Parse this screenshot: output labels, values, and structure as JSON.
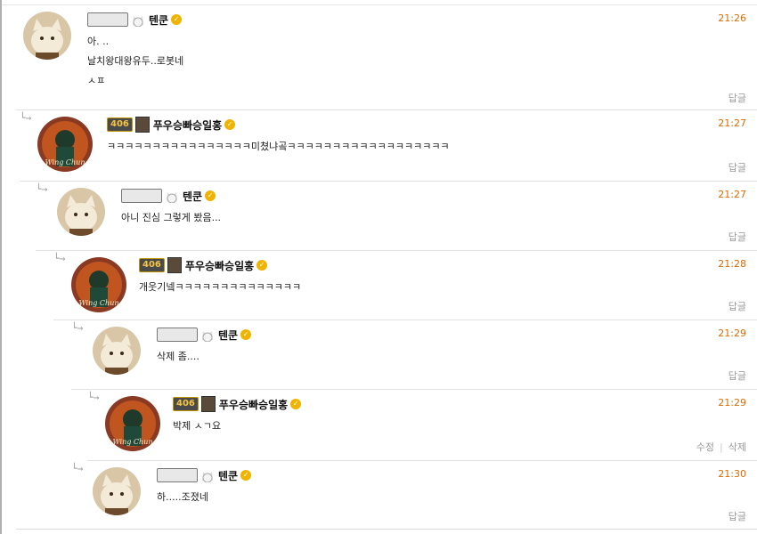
{
  "comments": [
    {
      "author": "텐쿤",
      "time": "21:26",
      "lines": [
        "아. ..",
        "날치왕대왕유두..로봇네",
        "ㅅㅍ"
      ],
      "reply": "답글"
    },
    {
      "author": "푸우승빠승일홍",
      "badge": "406",
      "time": "21:27",
      "lines": [
        "ㅋㅋㅋㅋㅋㅋㅋㅋㅋㅋㅋㅋㅋㅋㅋㅋ미쳤냐곸ㅋㅋㅋㅋㅋㅋㅋㅋㅋㅋㅋㅋㅋㅋㅋㅋㅋㅋ"
      ],
      "reply": "답글"
    },
    {
      "author": "텐쿤",
      "time": "21:27",
      "lines": [
        "아니 진심 그렇게 봤음..."
      ],
      "reply": "답글"
    },
    {
      "author": "푸우승빠승일홍",
      "badge": "406",
      "time": "21:28",
      "lines": [
        "개웃기넼ㅋㅋㅋㅋㅋㅋㅋㅋㅋㅋㅋㅋㅋㅋ"
      ],
      "reply": "답글"
    },
    {
      "author": "텐쿤",
      "time": "21:29",
      "lines": [
        "삭제 좀...."
      ],
      "reply": "답글"
    },
    {
      "author": "푸우승빠승일홍",
      "badge": "406",
      "time": "21:29",
      "lines": [
        "박제 ㅅㄱ요"
      ],
      "edit": "수정",
      "delete": "삭제"
    },
    {
      "author": "텐쿤",
      "time": "21:30",
      "lines": [
        "하.....조졌네"
      ],
      "reply": "답글"
    }
  ],
  "avatar_text": "Wing Chun",
  "colors": {
    "time": "#e06a00",
    "verified": "#f0b400",
    "muted": "#999999"
  }
}
